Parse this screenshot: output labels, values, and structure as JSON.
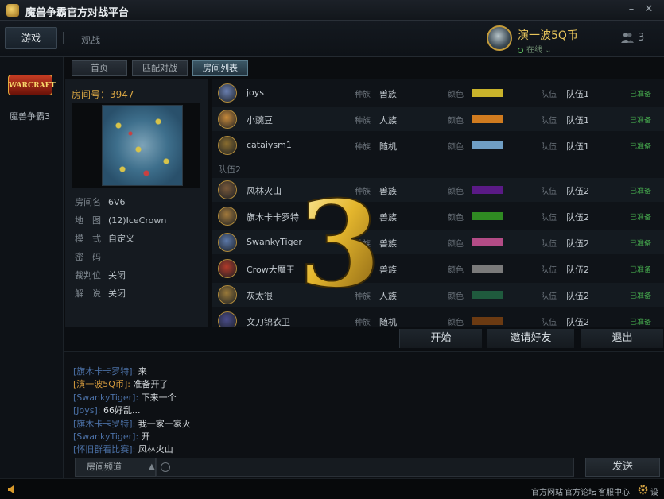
{
  "app": {
    "title": "魔兽争霸官方对战平台"
  },
  "header": {
    "tab_game": "游戏",
    "tab_watch": "观战",
    "user_name": "演一波5Q币",
    "user_status": "在线",
    "friends_count": "3"
  },
  "sidebar": {
    "game_label": "魔兽争霸3",
    "logo_text": "WARCRAFT"
  },
  "subnav": {
    "tabs": [
      "首页",
      "匹配对战",
      "房间列表"
    ],
    "active": "房间列表"
  },
  "room": {
    "id_label": "房间号：3947",
    "fields": [
      {
        "key": "房间名",
        "value": "6V6"
      },
      {
        "key": "地　图",
        "value": "(12)IceCrown"
      },
      {
        "key": "模　式",
        "value": "自定义"
      },
      {
        "key": "密　码",
        "value": ""
      },
      {
        "key": "裁判位",
        "value": "关闭"
      },
      {
        "key": "解　说",
        "value": "关闭"
      }
    ]
  },
  "players": {
    "race_key": "种族",
    "color_key": "颜色",
    "team_key": "队伍",
    "team2_header": "队伍2",
    "list": [
      {
        "name": "joys",
        "race": "兽族",
        "color": "#c9b32b",
        "team": "队伍1",
        "ready": "已准备",
        "avatar": "#6a7fb0"
      },
      {
        "name": "小豌豆",
        "race": "人族",
        "color": "#d07b1f",
        "team": "队伍1",
        "ready": "已准备",
        "avatar": "#c98b3b"
      },
      {
        "name": "cataiysm1",
        "race": "随机",
        "color": "#6f9ec4",
        "team": "队伍1",
        "ready": "已准备",
        "avatar": "#8a6d2f"
      },
      {
        "name": "风林火山",
        "race": "兽族",
        "color": "#5a1a86",
        "team": "队伍2",
        "ready": "已准备",
        "avatar": "#7a5a3a"
      },
      {
        "name": "旗木卡卡罗特",
        "race": "兽族",
        "color": "#2f8a22",
        "team": "队伍2",
        "ready": "已准备",
        "avatar": "#a37a3c"
      },
      {
        "name": "SwankyTiger",
        "race": "兽族",
        "color": "#b34c86",
        "team": "队伍2",
        "ready": "已准备",
        "avatar": "#5c78a8"
      },
      {
        "name": "Crow大魔王",
        "race": "兽族",
        "color": "#7a7a7a",
        "team": "队伍2",
        "ready": "已准备",
        "avatar": "#b33b2a"
      },
      {
        "name": "灰太很",
        "race": "人族",
        "color": "#1f5a3d",
        "team": "队伍2",
        "ready": "已准备",
        "avatar": "#9a7a3a"
      },
      {
        "name": "文刀锦衣卫",
        "race": "随机",
        "color": "#6b3a12",
        "team": "队伍2",
        "ready": "已准备",
        "avatar": "#4a4c8a"
      }
    ]
  },
  "countdown": "3",
  "actions": {
    "start": "开始",
    "invite": "邀请好友",
    "exit": "退出"
  },
  "chat": {
    "lines": [
      {
        "user": "[旗木卡卡罗特]:",
        "msg": "来",
        "self": false
      },
      {
        "user": "[演一波5Q币]:",
        "msg": "准备开了",
        "self": true
      },
      {
        "user": "[SwankyTiger]:",
        "msg": "下来一个",
        "self": false
      },
      {
        "user": "[Joys]:",
        "msg": "66好乱...",
        "self": false
      },
      {
        "user": "[旗木卡卡罗特]:",
        "msg": "我一家一家灭",
        "self": false
      },
      {
        "user": "[SwankyTiger]:",
        "msg": "开",
        "self": false
      },
      {
        "user": "[怀旧群看比赛]:",
        "msg": "风林火山",
        "self": false
      }
    ],
    "channel": "房间频道",
    "send": "发送"
  },
  "footer": {
    "links": [
      "官方网站",
      "官方论坛",
      "客服中心"
    ],
    "settings": "设置"
  }
}
